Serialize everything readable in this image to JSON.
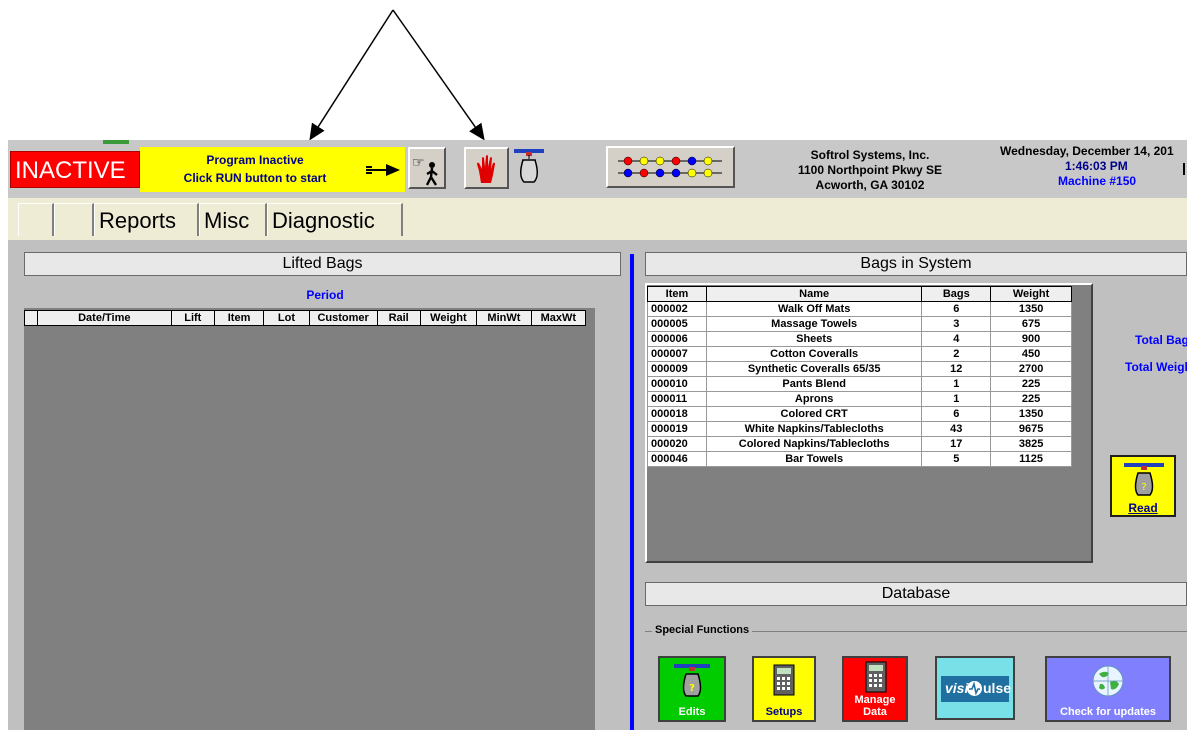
{
  "status": {
    "label": "INACTIVE",
    "line1": "Program Inactive",
    "line2": "Click RUN button to start"
  },
  "company": {
    "name": "Softrol Systems, Inc.",
    "address1": "1100 Northpoint Pkwy SE",
    "address2": "Acworth, GA 30102"
  },
  "clock": {
    "date": "Wednesday, December 14, 201",
    "time": "1:46:03 PM",
    "machine": "Machine #150"
  },
  "tabs": [
    "Reports",
    "Misc",
    "Diagnostic"
  ],
  "lifted": {
    "title": "Lifted Bags",
    "period": "Period",
    "columns": [
      "Date/Time",
      "Lift",
      "Item",
      "Lot",
      "Customer",
      "Rail",
      "Weight",
      "MinWt",
      "MaxWt"
    ]
  },
  "system": {
    "title": "Bags in System",
    "columns": [
      "Item",
      "Name",
      "Bags",
      "Weight"
    ],
    "rows": [
      [
        "000002",
        "Walk Off Mats",
        "6",
        "1350"
      ],
      [
        "000005",
        "Massage Towels",
        "3",
        "675"
      ],
      [
        "000006",
        "Sheets",
        "4",
        "900"
      ],
      [
        "000007",
        "Cotton Coveralls",
        "2",
        "450"
      ],
      [
        "000009",
        "Synthetic Coveralls 65/35",
        "12",
        "2700"
      ],
      [
        "000010",
        "Pants Blend",
        "1",
        "225"
      ],
      [
        "000011",
        "Aprons",
        "1",
        "225"
      ],
      [
        "000018",
        "Colored CRT",
        "6",
        "1350"
      ],
      [
        "000019",
        "White Napkins/Tablecloths",
        "43",
        "9675"
      ],
      [
        "000020",
        "Colored Napkins/Tablecloths",
        "17",
        "3825"
      ],
      [
        "000046",
        "Bar Towels",
        "5",
        "1125"
      ]
    ],
    "total_bags_label": "Total Bag",
    "total_weight_label": "Total Weigh",
    "read_label": "Read"
  },
  "database": {
    "title": "Database",
    "special_label": "Special Functions",
    "edits": "Edits",
    "setups": "Setups",
    "manage1": "Manage",
    "manage2": "Data",
    "visipulse_a": "visi",
    "visipulse_b": "ulse",
    "updates": "Check for updates"
  },
  "colors": {
    "inactive": "#ff0000",
    "message": "#ffff00",
    "edits": "#00cc00",
    "setups": "#ffff00",
    "manage": "#ff0000",
    "visipulse": "#79e0e8",
    "updates": "#8080ff",
    "divider": "#0000ff"
  },
  "icons": [
    "arrow-right-icon",
    "pointing-walk-icon",
    "stop-hand-icon",
    "bag-icon",
    "beads-icon",
    "calculator-icon",
    "globe-icon"
  ]
}
